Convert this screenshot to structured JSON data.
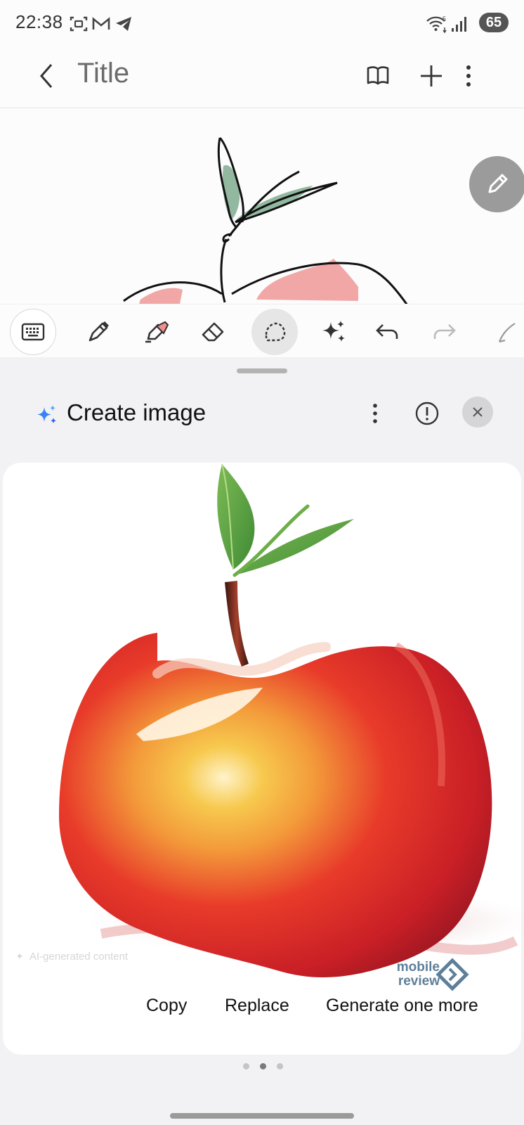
{
  "status_bar": {
    "time": "22:38",
    "battery": "65",
    "icons": [
      "screenshot-icon",
      "gmail-icon",
      "telegram-icon",
      "wifi-icon",
      "signal-icon"
    ]
  },
  "app_bar": {
    "title": "Title",
    "actions": [
      "book-icon",
      "plus-icon",
      "more-vert-icon"
    ]
  },
  "toolbar": {
    "tools": [
      "keyboard-icon",
      "pen-icon",
      "highlighter-icon",
      "eraser-icon",
      "lasso-icon",
      "ai-sparkle-icon",
      "undo-icon",
      "redo-icon",
      "pen-settings-icon"
    ],
    "selected": "lasso-icon"
  },
  "sheet": {
    "title": "Create image",
    "header_actions": [
      "more-vert-icon",
      "info-icon",
      "close-icon"
    ],
    "ai_badge": "AI-generated content",
    "watermark": {
      "line1": "mobile",
      "line2": "review"
    },
    "actions": {
      "copy": "Copy",
      "replace": "Replace",
      "generate": "Generate one more"
    },
    "pager": {
      "count": 3,
      "active": 1
    }
  },
  "colors": {
    "accent_sparkle": "#3b82f6",
    "apple_red": "#e12a24",
    "leaf_green": "#4e9a3a"
  }
}
